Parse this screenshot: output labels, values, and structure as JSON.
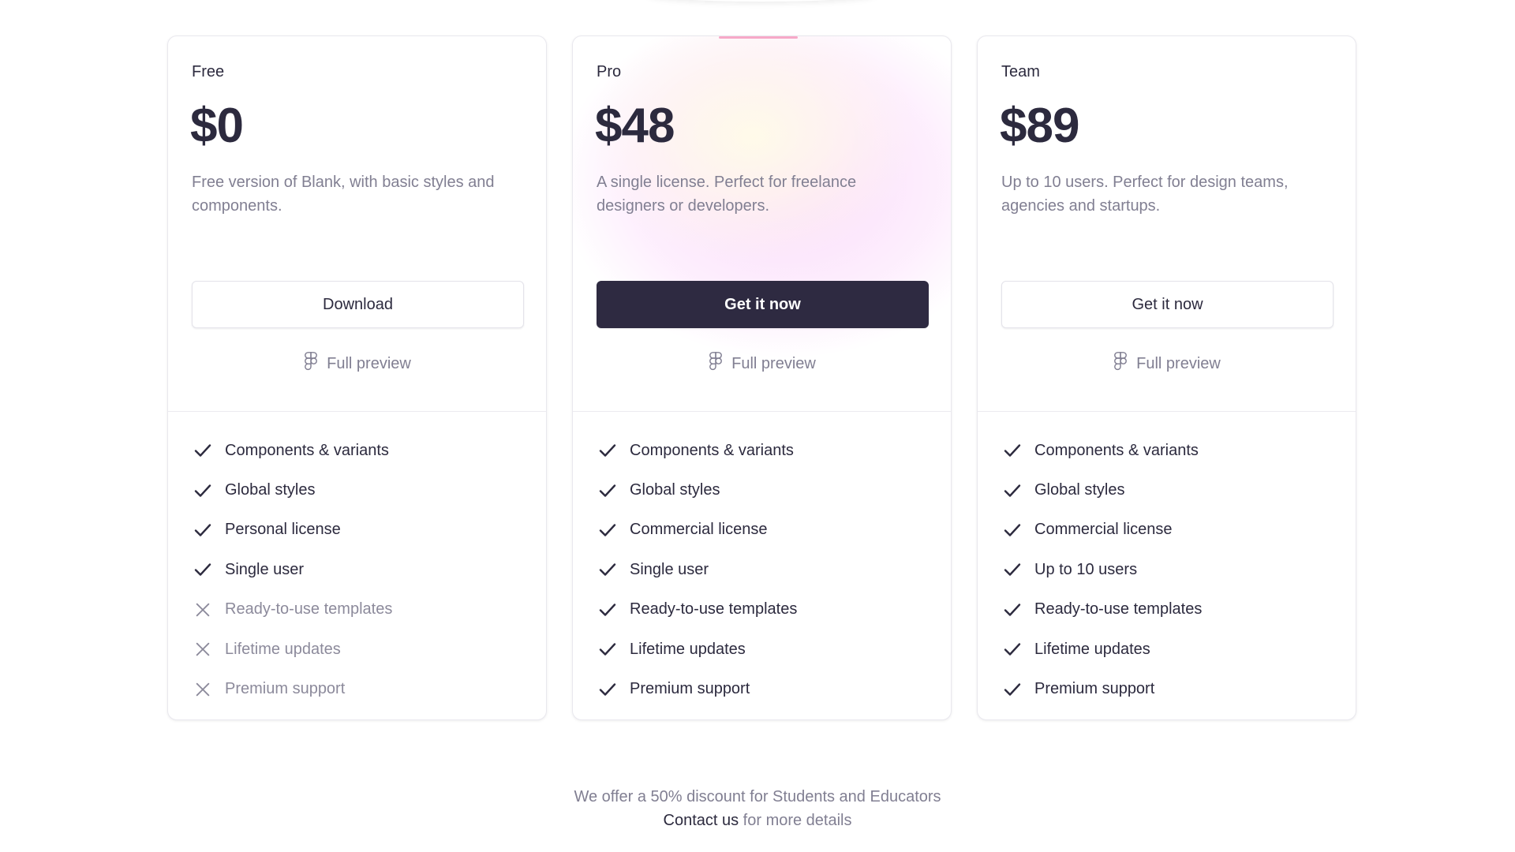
{
  "plans": [
    {
      "name": "Free",
      "price": "$0",
      "description": "Free version of Blank, with basic styles and components.",
      "cta": "Download",
      "preview": "Full preview",
      "features": [
        {
          "label": "Components & variants",
          "included": true
        },
        {
          "label": "Global styles",
          "included": true
        },
        {
          "label": "Personal license",
          "included": true
        },
        {
          "label": "Single user",
          "included": true
        },
        {
          "label": "Ready-to-use templates",
          "included": false
        },
        {
          "label": "Lifetime updates",
          "included": false
        },
        {
          "label": "Premium support",
          "included": false
        }
      ]
    },
    {
      "name": "Pro",
      "price": "$48",
      "description": "A single license. Perfect for freelance designers or developers.",
      "cta": "Get it now",
      "preview": "Full preview",
      "features": [
        {
          "label": "Components & variants",
          "included": true
        },
        {
          "label": "Global styles",
          "included": true
        },
        {
          "label": "Commercial license",
          "included": true
        },
        {
          "label": "Single user",
          "included": true
        },
        {
          "label": "Ready-to-use templates",
          "included": true
        },
        {
          "label": "Lifetime updates",
          "included": true
        },
        {
          "label": "Premium support",
          "included": true
        }
      ]
    },
    {
      "name": "Team",
      "price": "$89",
      "description": "Up to 10 users. Perfect for design teams, agencies and startups.",
      "cta": "Get it now",
      "preview": "Full preview",
      "features": [
        {
          "label": "Components & variants",
          "included": true
        },
        {
          "label": "Global styles",
          "included": true
        },
        {
          "label": "Commercial license",
          "included": true
        },
        {
          "label": "Up to 10 users",
          "included": true
        },
        {
          "label": "Ready-to-use templates",
          "included": true
        },
        {
          "label": "Lifetime updates",
          "included": true
        },
        {
          "label": "Premium support",
          "included": true
        }
      ]
    }
  ],
  "footer": {
    "discount": "We offer a 50% discount for Students and Educators",
    "contact_link": "Contact us",
    "contact_suffix": " for more details"
  },
  "icons": {
    "preview": "figma-icon",
    "included": "check-icon",
    "excluded": "x-icon"
  },
  "colors": {
    "primary_button": "#2e2a41",
    "text": "#2c2a3e",
    "muted": "#817f92",
    "accent": "#f7a9c8"
  }
}
